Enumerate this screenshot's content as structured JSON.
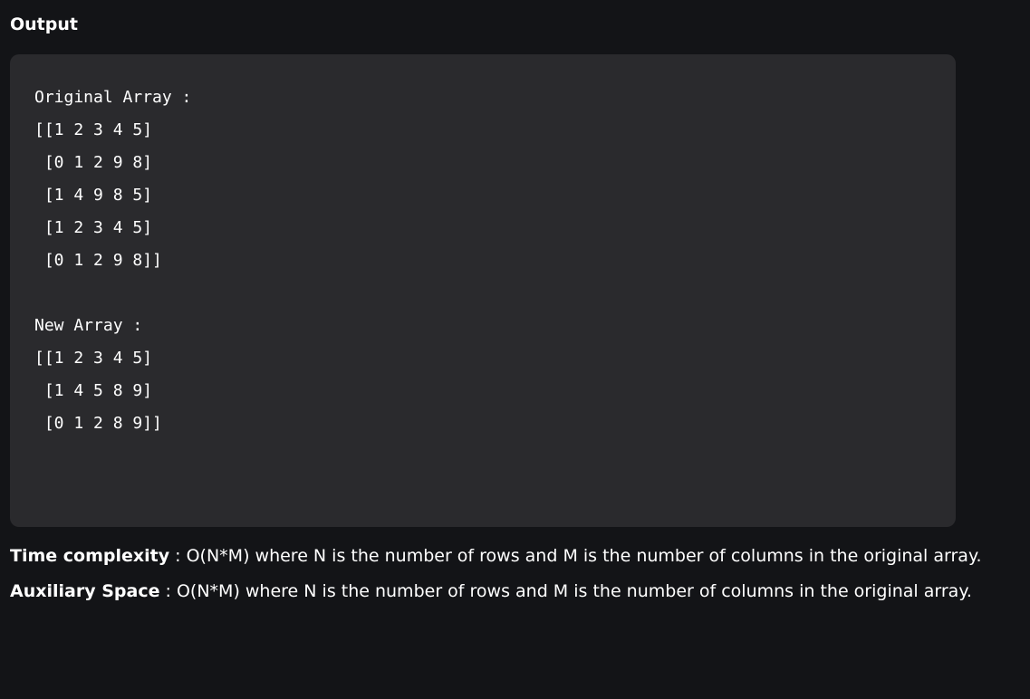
{
  "heading": "Output",
  "output": {
    "lines": [
      "Original Array :",
      "[[1 2 3 4 5]",
      " [0 1 2 9 8]",
      " [1 4 9 8 5]",
      " [1 2 3 4 5]",
      " [0 1 2 9 8]]",
      "",
      "New Array :",
      "[[1 2 3 4 5]",
      " [1 4 5 8 9]",
      " [0 1 2 8 9]]"
    ]
  },
  "notes": {
    "time": {
      "label": "Time complexity",
      "text": " : O(N*M) where N is the number of rows and M is the number of columns in the original array."
    },
    "space": {
      "label": "Auxiliary Space",
      "text": " : O(N*M) where N is the number of rows and M is the number of columns in the original array."
    }
  }
}
